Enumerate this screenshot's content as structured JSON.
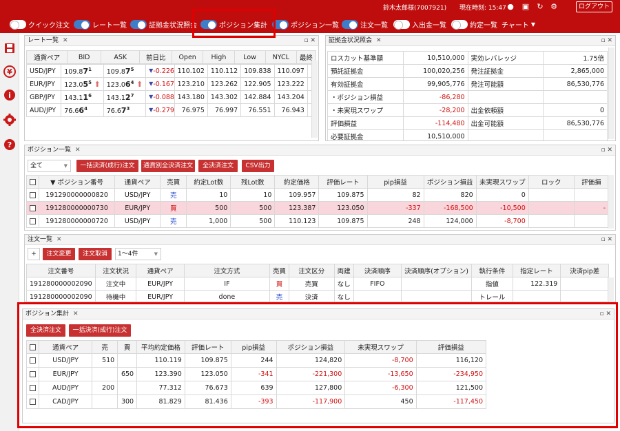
{
  "header": {
    "user": "鈴木太郎様(7007921)",
    "time": "現在時刻: 15:47",
    "logout": "ログアウト"
  },
  "toolbar": {
    "items": [
      "クイック注文",
      "レート一覧",
      "証拠金状況照会",
      "ポジション集計",
      "ポジション一覧",
      "注文一覧",
      "入出金一覧",
      "約定一覧"
    ],
    "chart": "チャート"
  },
  "rates": {
    "title": "レート一覧",
    "cols": [
      "通貨ペア",
      "BID",
      "ASK",
      "前日比",
      "Open",
      "High",
      "Low",
      "NYCL",
      "最終"
    ],
    "rows": [
      {
        "pair": "USD/JPY",
        "bid_a": "109.8",
        "bid_b": "7",
        "bid_c": "1",
        "ask_a": "109.8",
        "ask_b": "7",
        "ask_c": "5",
        "chg": "-0.226",
        "open": "110.102",
        "high": "110.112",
        "low": "109.838",
        "nycl": "110.097",
        "up": false
      },
      {
        "pair": "EUR/JPY",
        "bid_a": "123.0",
        "bid_b": "5",
        "bid_c": "5",
        "ask_a": "123.0",
        "ask_b": "6",
        "ask_c": "4",
        "chg": "-0.167",
        "open": "123.210",
        "high": "123.262",
        "low": "122.905",
        "nycl": "123.222",
        "up": true
      },
      {
        "pair": "GBP/JPY",
        "bid_a": "143.1",
        "bid_b": "1",
        "bid_c": "6",
        "ask_a": "143.1",
        "ask_b": "2",
        "ask_c": "7",
        "chg": "-0.088",
        "open": "143.180",
        "high": "143.302",
        "low": "142.884",
        "nycl": "143.204",
        "up": false
      },
      {
        "pair": "AUD/JPY",
        "bid_a": "76.6",
        "bid_b": "6",
        "bid_c": "4",
        "ask_a": "76.6",
        "ask_b": "7",
        "ask_c": "3",
        "chg": "-0.279",
        "open": "76.975",
        "high": "76.997",
        "low": "76.551",
        "nycl": "76.943",
        "up": false
      }
    ]
  },
  "margin": {
    "title": "証拠金状況照会",
    "rows": [
      {
        "k1": "ロスカット基準額",
        "v1": "10,510,000",
        "k2": "実効レバレッジ",
        "v2": "1.75倍"
      },
      {
        "k1": "預託証拠金",
        "v1": "100,020,256",
        "k2": "発注証拠金",
        "v2": "2,865,000"
      },
      {
        "k1": "有効証拠金",
        "v1": "99,905,776",
        "k2": "発注可能額",
        "v2": "86,530,776"
      },
      {
        "k1": "・ポジション損益",
        "v1": "-86,280",
        "k2": "",
        "v2": ""
      },
      {
        "k1": "・未実現スワップ",
        "v1": "-28,200",
        "k2": "出金依頼額",
        "v2": "0"
      },
      {
        "k1": "評価損益",
        "v1": "-114,480",
        "k2": "出金可能額",
        "v2": "86,530,776"
      },
      {
        "k1": "必要証拠金",
        "v1": "10,510,000",
        "k2": "",
        "v2": ""
      }
    ]
  },
  "positions": {
    "title": "ポジション一覧",
    "filter": "全て",
    "buttons": [
      "一括決済(成行)注文",
      "通貨別全決済注文",
      "全決済注文",
      "CSV出力"
    ],
    "cols": [
      "▼ ポジション番号",
      "通貨ペア",
      "売買",
      "約定Lot数",
      "残Lot数",
      "約定価格",
      "評価レート",
      "pip損益",
      "ポジション損益",
      "未実現スワップ",
      "ロック",
      "評価損"
    ],
    "rows": [
      {
        "no": "191290000000820",
        "pair": "USD/JPY",
        "side": "売",
        "lot": "10",
        "rem": "10",
        "price": "109.957",
        "rate": "109.875",
        "pip": "82",
        "pl": "820",
        "swap": "0",
        "lock": "",
        "ev": ""
      },
      {
        "no": "191280000000730",
        "pair": "EUR/JPY",
        "side": "買",
        "lot": "500",
        "rem": "500",
        "price": "123.387",
        "rate": "123.050",
        "pip": "-337",
        "pl": "-168,500",
        "swap": "-10,500",
        "lock": "",
        "ev": "-"
      },
      {
        "no": "191280000000720",
        "pair": "USD/JPY",
        "side": "売",
        "lot": "1,000",
        "rem": "500",
        "price": "110.123",
        "rate": "109.875",
        "pip": "248",
        "pl": "124,000",
        "swap": "-8,700",
        "lock": "",
        "ev": ""
      }
    ]
  },
  "orders": {
    "title": "注文一覧",
    "plus": "+",
    "buttons": [
      "注文変更",
      "注文取消"
    ],
    "count": "1～4件",
    "cols": [
      "注文番号",
      "注文状況",
      "通貨ペア",
      "注文方式",
      "売買",
      "注文区分",
      "両建",
      "決済順序",
      "決済順序(オプション)",
      "執行条件",
      "指定レート",
      "決済pip差"
    ],
    "rows": [
      {
        "no": "191280000002090",
        "st": "注文中",
        "pair": "EUR/JPY",
        "type": "IF",
        "side": "買",
        "cls": "売買",
        "both": "なし",
        "ord": "FIFO",
        "opt": "",
        "exec": "指値",
        "rate": "122.319",
        "pip": ""
      },
      {
        "no": "191280000002090",
        "st": "待機中",
        "pair": "EUR/JPY",
        "type": "done",
        "side": "売",
        "cls": "決済",
        "both": "なし",
        "ord": "",
        "opt": "",
        "exec": "トレール",
        "rate": "",
        "pip": ""
      }
    ]
  },
  "summary": {
    "title": "ポジション集計",
    "buttons": [
      "全決済注文",
      "一括決済(成行)注文"
    ],
    "cols": [
      "通貨ペア",
      "売",
      "買",
      "平均約定価格",
      "評価レート",
      "pip損益",
      "ポジション損益",
      "未実現スワップ",
      "評価損益"
    ],
    "rows": [
      {
        "pair": "USD/JPY",
        "sell": "510",
        "buy": "",
        "avg": "110.119",
        "rate": "109.875",
        "pip": "244",
        "pl": "124,820",
        "swap": "-8,700",
        "ev": "116,120"
      },
      {
        "pair": "EUR/JPY",
        "sell": "",
        "buy": "650",
        "avg": "123.390",
        "rate": "123.050",
        "pip": "-341",
        "pl": "-221,300",
        "swap": "-13,650",
        "ev": "-234,950"
      },
      {
        "pair": "AUD/JPY",
        "sell": "200",
        "buy": "",
        "avg": "77.312",
        "rate": "76.673",
        "pip": "639",
        "pl": "127,800",
        "swap": "-6,300",
        "ev": "121,500"
      },
      {
        "pair": "CAD/JPY",
        "sell": "",
        "buy": "300",
        "avg": "81.829",
        "rate": "81.436",
        "pip": "-393",
        "pl": "-117,900",
        "swap": "450",
        "ev": "-117,450"
      }
    ]
  }
}
